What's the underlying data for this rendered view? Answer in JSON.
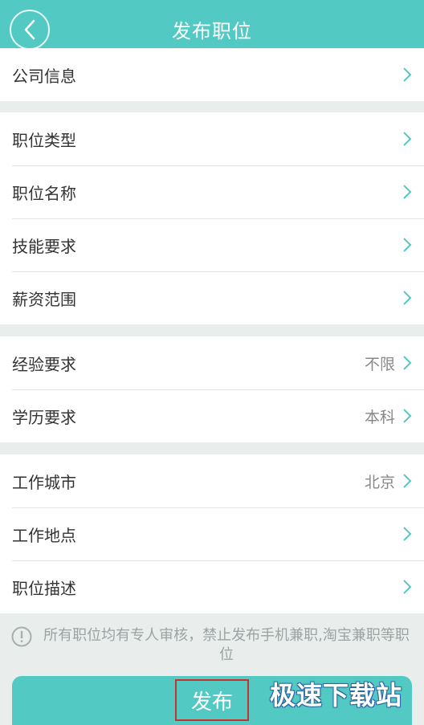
{
  "header": {
    "title": "发布职位",
    "back_icon": "chevron-left-icon"
  },
  "groups": [
    {
      "items": [
        {
          "label": "公司信息",
          "value": ""
        }
      ]
    },
    {
      "items": [
        {
          "label": "职位类型",
          "value": ""
        },
        {
          "label": "职位名称",
          "value": ""
        },
        {
          "label": "技能要求",
          "value": ""
        },
        {
          "label": "薪资范围",
          "value": ""
        }
      ]
    },
    {
      "items": [
        {
          "label": "经验要求",
          "value": "不限"
        },
        {
          "label": "学历要求",
          "value": "本科"
        }
      ]
    },
    {
      "items": [
        {
          "label": "工作城市",
          "value": "北京"
        },
        {
          "label": "工作地点",
          "value": ""
        },
        {
          "label": "职位描述",
          "value": ""
        }
      ]
    }
  ],
  "notice": {
    "text": "所有职位均有专人审核，禁止发布手机兼职,淘宝兼职等职位",
    "icon": "exclamation-circle-icon"
  },
  "publish_button": {
    "label": "发布"
  },
  "watermark": {
    "text": "极速下载站"
  },
  "colors": {
    "accent": "#52c9c2",
    "chevron": "#52c9c2",
    "highlight_border": "#c9302c"
  }
}
